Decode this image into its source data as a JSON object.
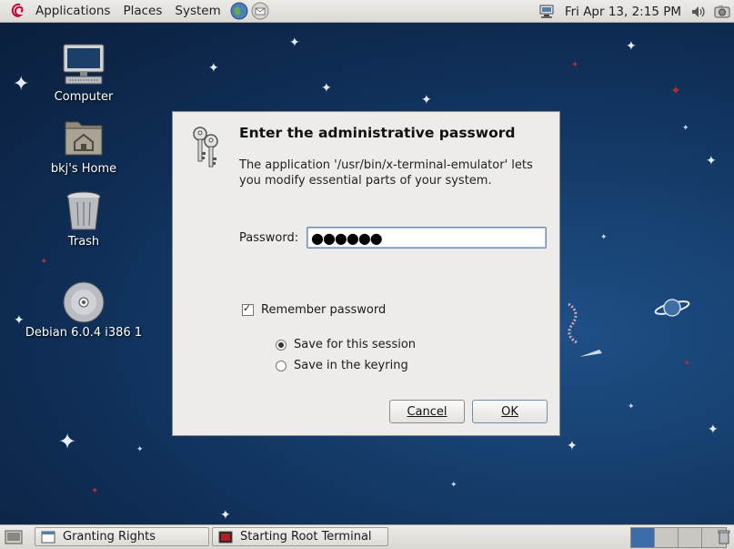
{
  "top_panel": {
    "menus": [
      "Applications",
      "Places",
      "System"
    ],
    "clock": "Fri Apr 13,  2:15 PM"
  },
  "desktop": {
    "icons": [
      {
        "label": "Computer",
        "icon": "computer-icon"
      },
      {
        "label": "bkj's Home",
        "icon": "home-folder-icon"
      },
      {
        "label": "Trash",
        "icon": "trash-icon"
      },
      {
        "label": "Debian 6.0.4 i386 1",
        "icon": "cdrom-icon"
      }
    ]
  },
  "dialog": {
    "title": "Enter the administrative password",
    "description": "The application '/usr/bin/x-terminal-emulator' lets you modify essential parts of your system.",
    "password_label": "Password:",
    "password_value": "●●●●●●",
    "remember_label": "Remember password",
    "remember_checked": true,
    "options": [
      {
        "label": "Save for this session",
        "selected": true
      },
      {
        "label": "Save in the keyring",
        "selected": false
      }
    ],
    "cancel_label": "Cancel",
    "ok_label": "OK"
  },
  "taskbar": {
    "tasks": [
      "Granting Rights",
      "Starting Root Terminal"
    ],
    "workspace_count": 4,
    "active_workspace": 1
  },
  "colors": {
    "desktop_bg": "#16406f",
    "panel_bg": "#dcdad5",
    "dialog_bg": "#edecea",
    "active_workspace": "#3b6ea8"
  }
}
